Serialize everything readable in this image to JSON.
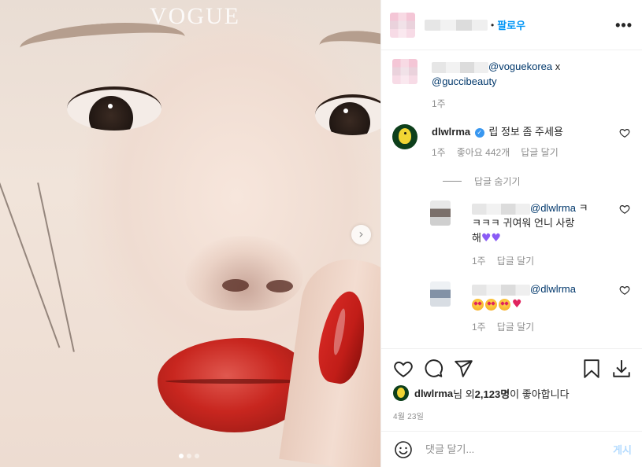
{
  "photo": {
    "logo_text": "VOGUE"
  },
  "header": {
    "separator": "•",
    "follow_label": "팔로우",
    "more_label": "•••"
  },
  "caption": {
    "mention1": "@voguekorea",
    "connector": " x",
    "mention2": "@guccibeauty",
    "time": "1주"
  },
  "comment": {
    "username": "dlwlrma",
    "verified_icon": "verified-badge-icon",
    "text": "립 정보 좀 주세용",
    "time": "1주",
    "likes": "좋아요 442개",
    "reply_label": "답글 달기",
    "hide_replies_label": "답글 숨기기"
  },
  "replies": [
    {
      "mention": "@dlwlrma",
      "text_line1": " ㅋ",
      "text_line2": "ㅋㅋㅋ 귀여워 언니 사랑",
      "text_line3": "해",
      "emojis": [
        "purple-heart",
        "purple-heart"
      ],
      "time": "1주",
      "reply_label": "답글 달기"
    },
    {
      "mention": "@dlwlrma",
      "emojis": [
        "star-struck",
        "star-struck",
        "star-struck",
        "red-heart"
      ],
      "time": "1주",
      "reply_label": "답글 달기"
    }
  ],
  "actions": {
    "icons": [
      "heart-icon",
      "comment-icon",
      "share-icon",
      "bookmark-icon",
      "download-icon"
    ],
    "liked_by_user": "dlwlrma",
    "likes_mid": "님 외 ",
    "likes_count": "2,123명",
    "likes_tail": "이 좋아합니다",
    "date": "4월 23일"
  },
  "comment_box": {
    "placeholder": "댓글 달기...",
    "post_label": "게시"
  },
  "colors": {
    "accent": "#0095f6",
    "mention": "#00376b",
    "muted": "#8e8e8e",
    "post_disabled": "#b3dbff",
    "verified": "#3897f0"
  }
}
